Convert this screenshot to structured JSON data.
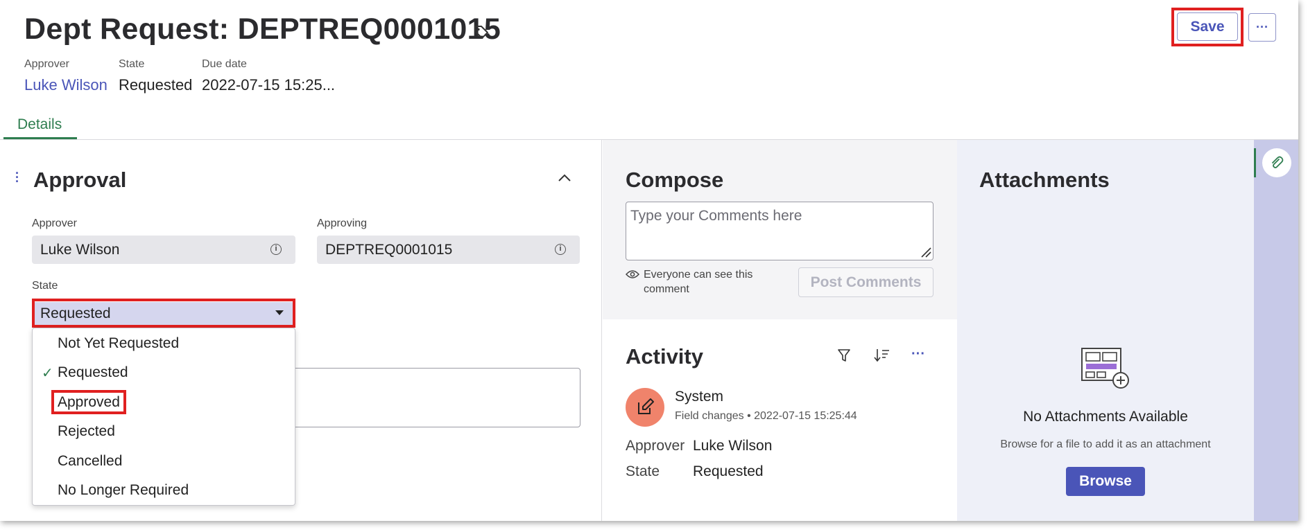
{
  "header": {
    "title": "Dept Request: DEPTREQ0001015",
    "save_label": "Save",
    "more_label": "···",
    "meta": [
      {
        "label": "Approver",
        "value": "Luke Wilson"
      },
      {
        "label": "State",
        "value": "Requested"
      },
      {
        "label": "Due date",
        "value": "2022-07-15 15:25..."
      }
    ]
  },
  "tabs": [
    {
      "label": "Details",
      "selected": true
    }
  ],
  "approval": {
    "title": "Approval",
    "approver_label": "Approver",
    "approver_value": "Luke Wilson",
    "approving_label": "Approving",
    "approving_value": "DEPTREQ0001015",
    "state_label": "State",
    "state_value": "Requested",
    "state_options": [
      "Not Yet Requested",
      "Requested",
      "Approved",
      "Rejected",
      "Cancelled",
      "No Longer Required"
    ],
    "checked_option": "Requested",
    "highlighted_option": "Approved"
  },
  "compose": {
    "title": "Compose",
    "placeholder": "Type your Comments here",
    "visibility_text": "Everyone can see this comment",
    "post_label": "Post Comments"
  },
  "activity": {
    "title": "Activity",
    "entries": [
      {
        "author": "System",
        "type": "Field changes",
        "timestamp": "2022-07-15 15:25:44",
        "changes": [
          {
            "field": "Approver",
            "value": "Luke Wilson"
          },
          {
            "field": "State",
            "value": "Requested"
          }
        ]
      }
    ]
  },
  "attachments": {
    "title": "Attachments",
    "empty_title": "No Attachments Available",
    "empty_hint": "Browse for a file to add it as an attachment",
    "browse_label": "Browse"
  },
  "colors": {
    "accent": "#4a55b8",
    "highlight": "#e02020",
    "tab_green": "#2e7d4f",
    "avatar": "#f0836b"
  }
}
